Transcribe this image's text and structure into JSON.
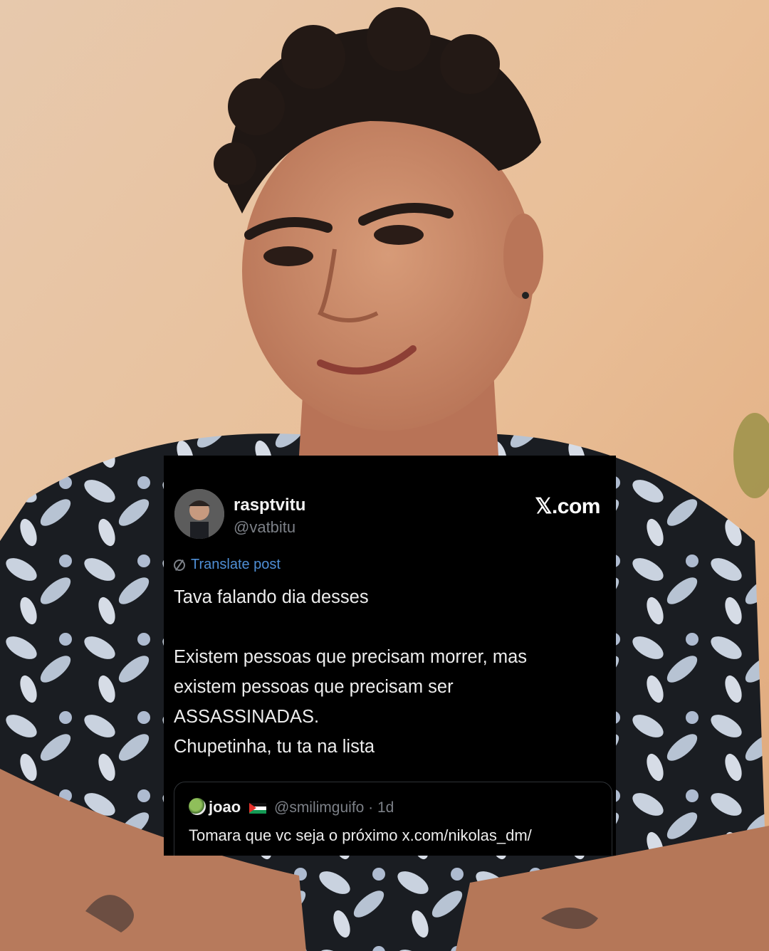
{
  "post": {
    "author_name": "rasptvitu",
    "author_handle": "@vatbitu",
    "brand": "𝕏.com",
    "translate_label": "Translate post",
    "lines": [
      "Tava falando dia desses",
      "",
      "Existem pessoas que precisam morrer, mas",
      "existem pessoas que precisam ser",
      "ASSASSINADAS.",
      "Chupetinha, tu ta na lista"
    ],
    "quote": {
      "author_name": "joao",
      "author_handle_time": "@smilimguifo · 1d",
      "text": "Tomara que vc seja o próximo x.com/nikolas_dm/"
    }
  },
  "colors": {
    "card_bg": "#000000",
    "link_blue": "#4f8fd6",
    "muted": "#7c8087",
    "background_peach": "#e8c2a0"
  },
  "icons": [
    "translate-icon",
    "avatar",
    "palestine-flag-icon"
  ]
}
